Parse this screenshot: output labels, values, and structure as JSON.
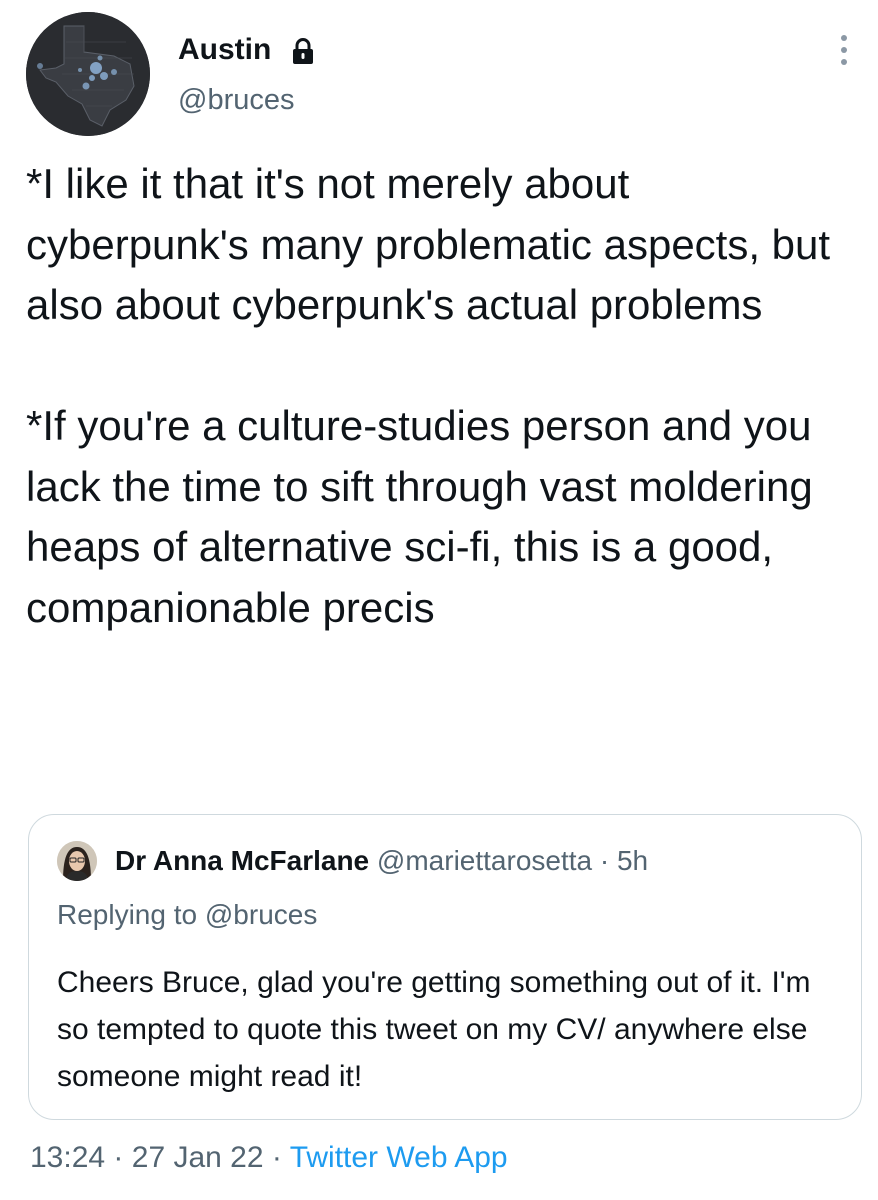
{
  "author": {
    "name": "Austin",
    "handle": "@bruces",
    "lock_icon": "lock-icon",
    "more_icon": "more-vertical-icon"
  },
  "tweet": {
    "text": "*I like it that it's not merely about cyberpunk's many problematic aspects, but also about cyberpunk's actual problems\n\n*If you're a culture-studies person and you lack the time to sift through vast moldering heaps of alternative sci-fi, this is a good, companionable precis"
  },
  "quote": {
    "name": "Dr Anna McFarlane",
    "handle": "@mariettarosetta",
    "separator": "·",
    "age": "5h",
    "replying_prefix": "Replying to",
    "replying_to": "@bruces",
    "text": "Cheers Bruce, glad you're getting something out of it. I'm so tempted to quote this tweet on my CV/ anywhere else someone might read it!"
  },
  "footer": {
    "time": "13:24",
    "sep1": "·",
    "date": "27 Jan 22",
    "sep2": "·",
    "source": "Twitter Web App"
  },
  "colors": {
    "text": "#0f1419",
    "secondary": "#536471",
    "link": "#1d9bf0",
    "border": "#cfd9de"
  }
}
